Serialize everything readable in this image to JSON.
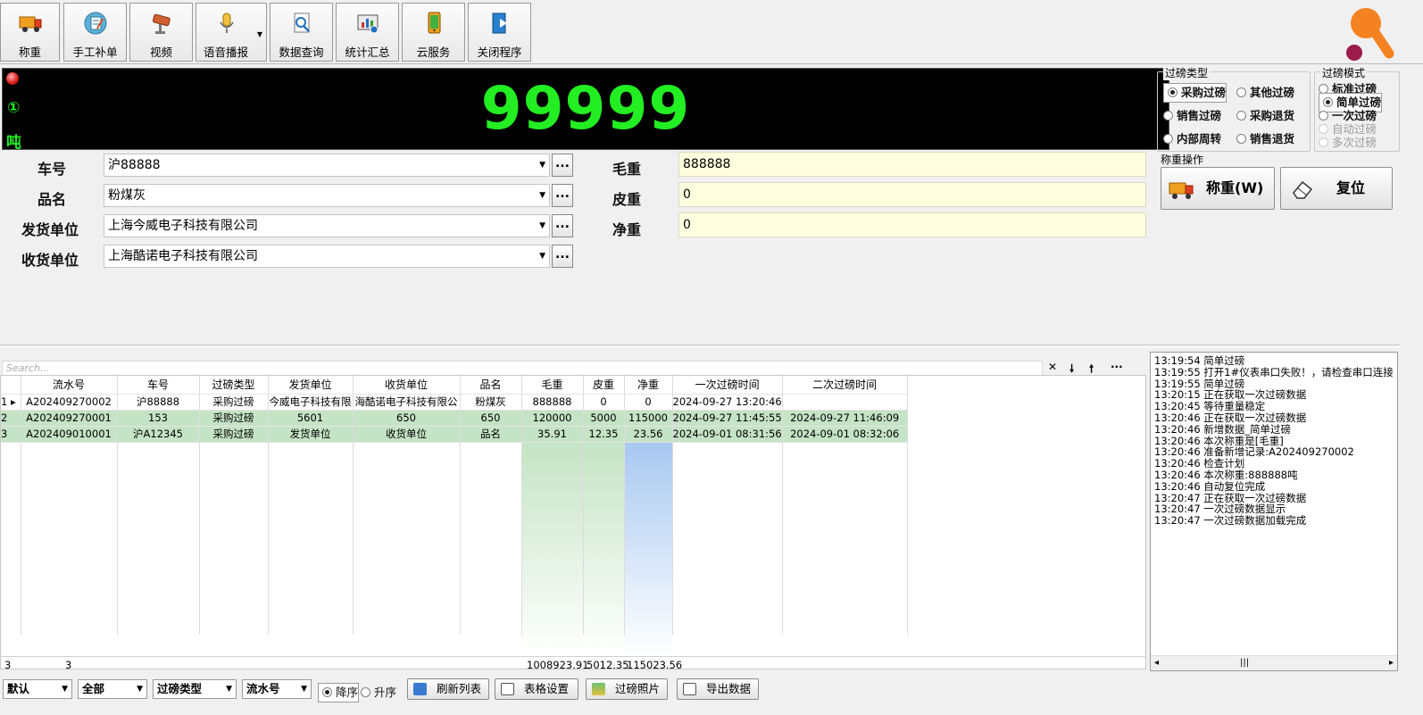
{
  "toolbar": {
    "buttons": [
      {
        "label": "称重",
        "icon": "truck-icon"
      },
      {
        "label": "手工补单",
        "icon": "edit-form-icon"
      },
      {
        "label": "视频",
        "icon": "camera-icon"
      },
      {
        "label": "语音播报",
        "icon": "microphone-icon"
      },
      {
        "label": "数据查询",
        "icon": "search-document-icon"
      },
      {
        "label": "统计汇总",
        "icon": "statistics-icon"
      },
      {
        "label": "云服务",
        "icon": "phone-icon"
      },
      {
        "label": "关闭程序",
        "icon": "exit-icon"
      }
    ]
  },
  "display": {
    "value": "99999",
    "scale_symbol": "①",
    "unit": "吨"
  },
  "weigh_type": {
    "title": "过磅类型",
    "options": [
      "采购过磅",
      "其他过磅",
      "销售过磅",
      "采购退货",
      "内部周转",
      "销售退货"
    ],
    "selected": "采购过磅"
  },
  "weigh_mode": {
    "title": "过磅模式",
    "options": [
      "标准过磅",
      "简单过磅",
      "一次过磅",
      "自动过磅",
      "多次过磅"
    ],
    "selected": "简单过磅",
    "disabled": [
      "自动过磅",
      "多次过磅"
    ]
  },
  "form": {
    "plate_label": "车号",
    "plate_value": "沪88888",
    "product_label": "品名",
    "product_value": "粉煤灰",
    "sender_label": "发货单位",
    "sender_value": "上海今威电子科技有限公司",
    "receiver_label": "收货单位",
    "receiver_value": "上海酷诺电子科技有限公司",
    "ellipsis": "...",
    "gross_label": "毛重",
    "gross_value": "888888",
    "tare_label": "皮重",
    "tare_value": "0",
    "net_label": "净重",
    "net_value": "0"
  },
  "operations": {
    "title": "称重操作",
    "weigh_label": "称重(W)",
    "reset_label": "复位"
  },
  "search": {
    "placeholder": "Search..."
  },
  "grid": {
    "headers": [
      "流水号",
      "车号",
      "过磅类型",
      "发货单位",
      "收货单位",
      "品名",
      "毛重",
      "皮重",
      "净重",
      "一次过磅时间",
      "二次过磅时间"
    ],
    "rows": [
      {
        "index": "1",
        "cells": [
          "A202409270002",
          "沪88888",
          "采购过磅",
          "今威电子科技有限",
          "海酷诺电子科技有限公",
          "粉煤灰",
          "888888",
          "0",
          "0",
          "2024-09-27 13:20:46",
          ""
        ]
      },
      {
        "index": "2",
        "cells": [
          "A202409270001",
          "153",
          "采购过磅",
          "5601",
          "650",
          "650",
          "120000",
          "5000",
          "115000",
          "2024-09-27 11:45:55",
          "2024-09-27 11:46:09"
        ]
      },
      {
        "index": "3",
        "cells": [
          "A202409010001",
          "沪A12345",
          "采购过磅",
          "发货单位",
          "收货单位",
          "品名",
          "35.91",
          "12.35",
          "23.56",
          "2024-09-01 08:31:56",
          "2024-09-01 08:32:06"
        ]
      }
    ],
    "footer": {
      "index": "3",
      "count": "3",
      "gross": "1008923.91",
      "tare": "5012.35",
      "net": "115023.56"
    }
  },
  "log": [
    "13:19:54 简单过磅",
    "13:19:55 打开1#仪表串口失败！，请检查串口连接",
    "13:19:55 简单过磅",
    "13:20:15 正在获取一次过磅数据",
    "13:20:45 等待重量稳定",
    "13:20:46 正在获取一次过磅数据",
    "13:20:46 新增数据_简单过磅",
    "13:20:46 本次称重是[毛重]",
    "13:20:46 准备新增记录:A202409270002",
    "13:20:46 检查计划",
    "13:20:46 本次称重:888888吨",
    "13:20:46 自动复位完成",
    "13:20:47 正在获取一次过磅数据",
    "13:20:47 一次过磅数据显示",
    "13:20:47 一次过磅数据加载完成"
  ],
  "bottom": {
    "selects": [
      "默认",
      "全部",
      "过磅类型",
      "流水号"
    ],
    "sort_desc": "降序",
    "sort_asc": "升序",
    "buttons": [
      "刷新列表",
      "表格设置",
      "过磅照片",
      "导出数据"
    ]
  },
  "colors": {
    "display_green": "#22ee22",
    "row_highlight": "#c5e3c5",
    "logo_orange": "#f58220",
    "logo_maroon": "#9b1b4a"
  }
}
